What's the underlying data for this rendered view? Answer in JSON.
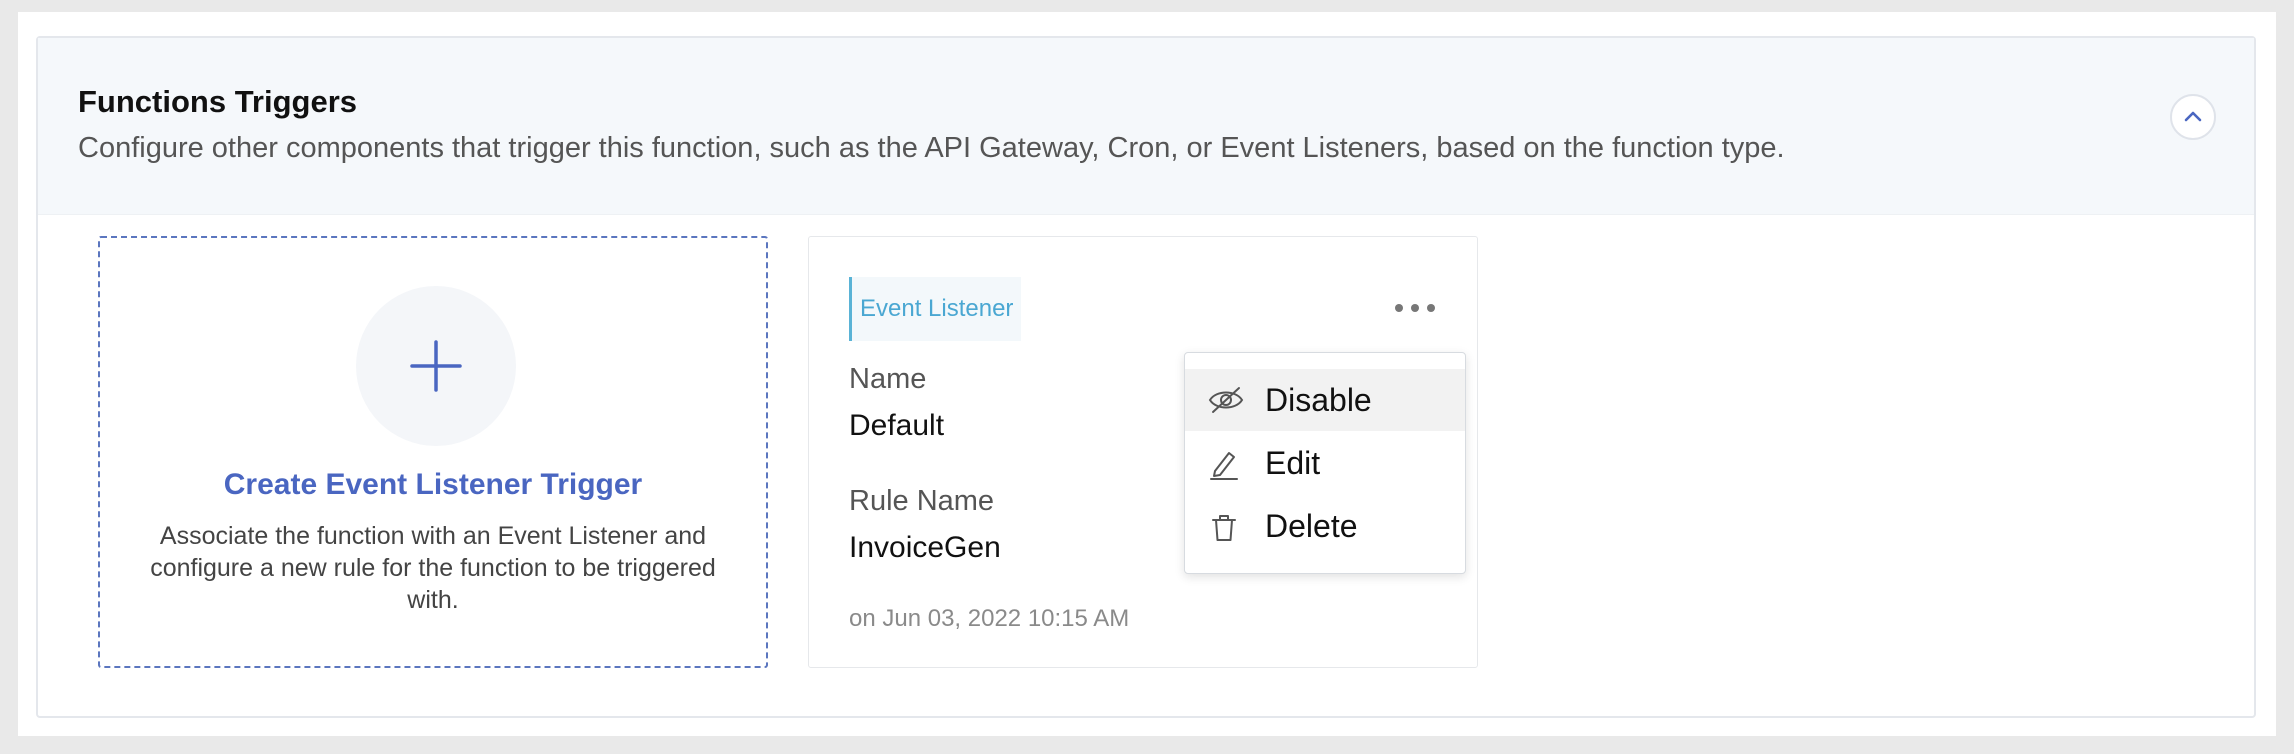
{
  "section": {
    "title": "Functions Triggers",
    "description": "Configure other components that trigger this function, such as the API Gateway, Cron, or Event Listeners, based on the function type.",
    "collapse_icon": "chevron-up-icon"
  },
  "create_card": {
    "icon": "plus-icon",
    "title": "Create Event Listener Trigger",
    "description": "Associate the function with an Event Listener and configure a new rule for the function to be triggered with."
  },
  "trigger_card": {
    "tag": "Event Listener",
    "more_icon": "more-horizontal-icon",
    "name_label": "Name",
    "name_value": "Default",
    "rule_label": "Rule Name",
    "rule_value": "InvoiceGen",
    "timestamp": "on Jun 03, 2022 10:15 AM"
  },
  "menu": {
    "items": [
      {
        "label": "Disable",
        "icon": "eye-slash-icon"
      },
      {
        "label": "Edit",
        "icon": "pencil-icon"
      },
      {
        "label": "Delete",
        "icon": "trash-icon"
      }
    ]
  },
  "colors": {
    "accent": "#4a66c1",
    "tag_text": "#4aa7d2",
    "header_bg": "#f5f8fb"
  }
}
